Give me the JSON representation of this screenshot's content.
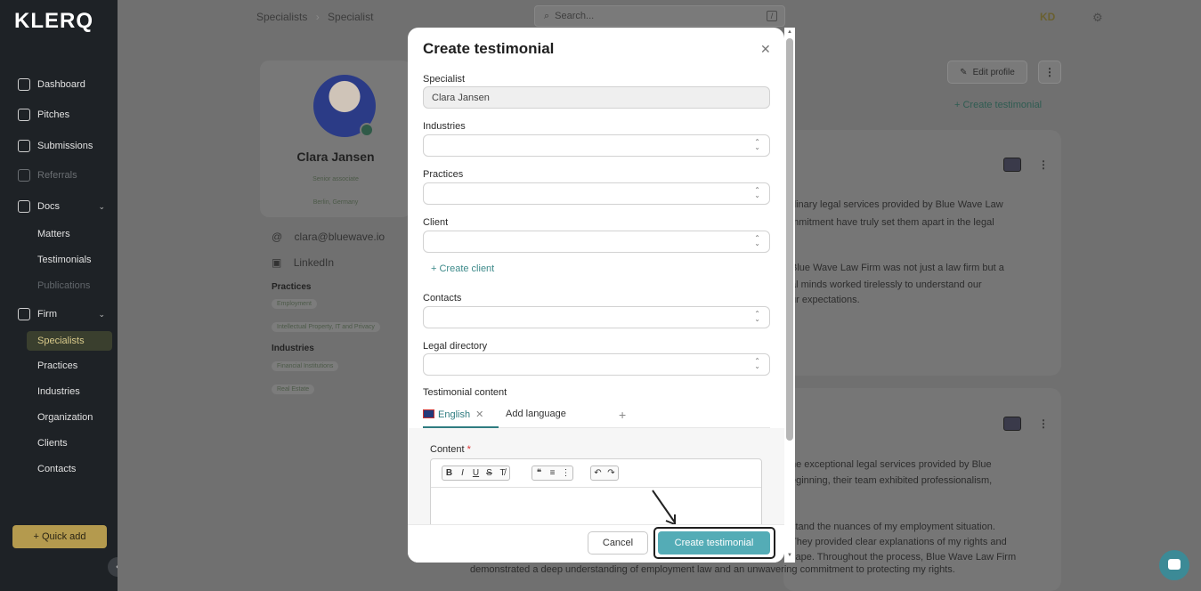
{
  "app": {
    "logo": "KLERQ"
  },
  "sidebar": {
    "items": [
      {
        "label": "Dashboard",
        "icon": "home-icon"
      },
      {
        "label": "Pitches",
        "icon": "presentation-icon"
      },
      {
        "label": "Submissions",
        "icon": "file-icon"
      },
      {
        "label": "Referrals",
        "icon": "chat-icon"
      },
      {
        "label": "Docs",
        "icon": "folder-icon"
      },
      {
        "label": "Firm",
        "icon": "bank-icon"
      }
    ],
    "docs_children": [
      "Matters",
      "Testimonials",
      "Publications"
    ],
    "firm_children": [
      "Specialists",
      "Practices",
      "Industries",
      "Organization",
      "Clients",
      "Contacts"
    ],
    "quick_add": "+ Quick add"
  },
  "topbar": {
    "breadcrumb_root": "Specialists",
    "breadcrumb_current": "Specialist",
    "search_placeholder": "Search...",
    "search_kbd": "/",
    "user_initials": "KD"
  },
  "profile": {
    "name": "Clara Jansen",
    "title": "Senior associate",
    "location": "Berlin, Germany",
    "email": "clara@bluewave.io",
    "linkedin": "LinkedIn",
    "practices_label": "Practices",
    "practices": [
      "Employment",
      "Intellectual Property, IT and Privacy"
    ],
    "industries_label": "Industries",
    "industries": [
      "Financial Institutions",
      "Real Estate"
    ]
  },
  "page_actions": {
    "edit_profile": "Edit profile",
    "create_testimonial": "+ Create testimonial"
  },
  "background_text": {
    "card1_line1": "dinary legal services provided by Blue Wave Law",
    "card1_line2": "mmitment have truly set them apart in the legal",
    "card1_line3": "Blue Wave Law Firm was not just a law firm but a",
    "card1_line4": "al minds worked tirelessly to understand our",
    "card1_line5": "ur expectations.",
    "card2_line1": "he exceptional legal services provided by Blue",
    "card2_line2": "eginning, their team exhibited professionalism,",
    "card2_line3": "stand the nuances of my employment situation.",
    "card2_line4": "They provided clear explanations of my rights and",
    "card2_line5": "cape. Throughout the process, Blue Wave Law Firm",
    "bottom_line": "demonstrated a deep understanding of employment law and an unwavering commitment to protecting my rights."
  },
  "modal": {
    "title": "Create testimonial",
    "specialist_label": "Specialist",
    "specialist_value": "Clara Jansen",
    "industries_label": "Industries",
    "practices_label": "Practices",
    "client_label": "Client",
    "create_client": "+ Create client",
    "contacts_label": "Contacts",
    "legal_directory_label": "Legal directory",
    "testimonial_content_label": "Testimonial content",
    "tab_english": "English",
    "tab_add_language": "Add language",
    "content_label": "Content",
    "required_mark": "*",
    "cancel": "Cancel",
    "submit": "Create testimonial"
  },
  "colors": {
    "accent": "#54acb6",
    "link": "#3d8a8a",
    "sidebar_bg": "#1e2226",
    "quick_add": "#b49a4e"
  }
}
